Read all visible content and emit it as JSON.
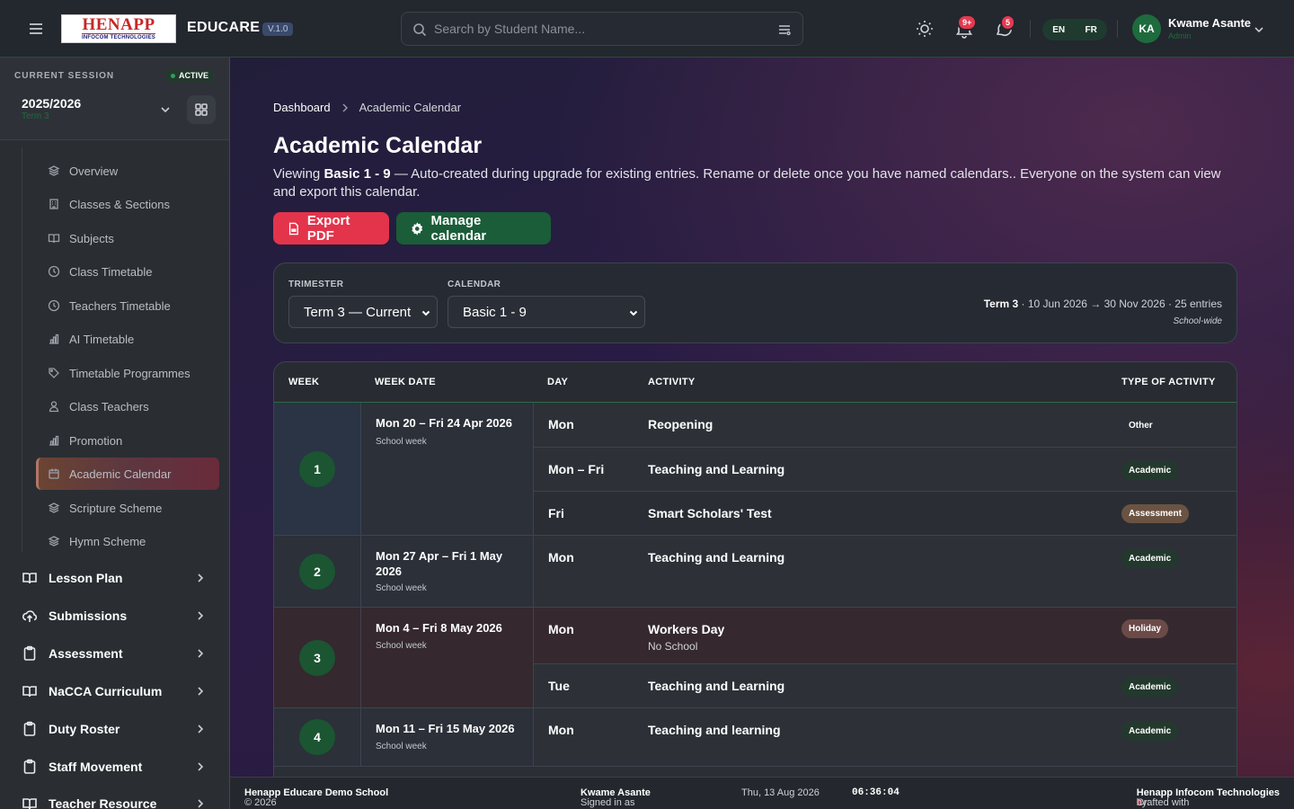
{
  "app": {
    "brand": "EDUCARE",
    "version": "V.1.0",
    "logo_main": "HENAPP",
    "logo_sub": "INFOCOM TECHNOLOGIES"
  },
  "search": {
    "placeholder": "Search by Student Name..."
  },
  "topbar": {
    "notif_badge": "9+",
    "msg_badge": "5",
    "lang_en": "EN",
    "lang_fr": "FR",
    "user_initials": "KA",
    "user_name": "Kwame Asante",
    "user_role": "Admin"
  },
  "session": {
    "label": "CURRENT SESSION",
    "status": "ACTIVE",
    "year": "2025/2026",
    "term": "Term 3"
  },
  "sidebar": {
    "items": [
      {
        "label": "Overview",
        "icon": "layers-icon"
      },
      {
        "label": "Classes & Sections",
        "icon": "building-icon"
      },
      {
        "label": "Subjects",
        "icon": "book-icon"
      },
      {
        "label": "Class Timetable",
        "icon": "clock-icon"
      },
      {
        "label": "Teachers Timetable",
        "icon": "clock-icon"
      },
      {
        "label": "AI Timetable",
        "icon": "chart-icon"
      },
      {
        "label": "Timetable Programmes",
        "icon": "tag-icon"
      },
      {
        "label": "Class Teachers",
        "icon": "user-icon"
      },
      {
        "label": "Promotion",
        "icon": "chart-icon"
      },
      {
        "label": "Academic Calendar",
        "icon": "calendar-icon"
      },
      {
        "label": "Scripture Scheme",
        "icon": "layers-icon"
      },
      {
        "label": "Hymn Scheme",
        "icon": "layers-icon"
      }
    ],
    "groups": [
      {
        "label": "Lesson Plan"
      },
      {
        "label": "Submissions"
      },
      {
        "label": "Assessment"
      },
      {
        "label": "NaCCA Curriculum"
      },
      {
        "label": "Duty Roster"
      },
      {
        "label": "Staff Movement"
      },
      {
        "label": "Teacher Resource"
      }
    ]
  },
  "breadcrumb": {
    "home": "Dashboard",
    "current": "Academic Calendar"
  },
  "page": {
    "title": "Academic Calendar",
    "intro_prefix": "Viewing ",
    "intro_bold": "Basic 1 - 9",
    "intro_rest": " — Auto-created during upgrade for existing entries. Rename or delete once you have named calendars.. Everyone on the system can view and export this calendar.",
    "export_btn": "Export PDF",
    "manage_btn": "Manage calendar"
  },
  "filters": {
    "trimester_label": "TRIMESTER",
    "trimester_value": "Term 3 — Current",
    "calendar_label": "CALENDAR",
    "calendar_value": "Basic 1 - 9",
    "meta_term": "Term 3",
    "meta_rest": " · 10 Jun 2026 → 30 Nov 2026 · 25 entries",
    "scope": "School-wide"
  },
  "table": {
    "headers": {
      "week": "WEEK",
      "date": "WEEK DATE",
      "day": "DAY",
      "activity": "ACTIVITY",
      "type": "TYPE OF ACTIVITY"
    },
    "weeks": [
      {
        "num": "1",
        "date": "Mon 20 – Fri 24 Apr 2026",
        "sub": "School week"
      },
      {
        "num": "2",
        "date": "Mon 27 Apr – Fri 1 May 2026",
        "sub": "School week"
      },
      {
        "num": "3",
        "date": "Mon 4 – Fri 8 May 2026",
        "sub": "School week"
      },
      {
        "num": "4",
        "date": "Mon 11 – Fri 15 May 2026",
        "sub": "School week"
      }
    ],
    "rows": [
      {
        "day": "Mon",
        "activity": "Reopening",
        "sub": "",
        "type": "Other"
      },
      {
        "day": "Mon – Fri",
        "activity": "Teaching and Learning",
        "sub": "",
        "type": "Academic"
      },
      {
        "day": "Fri",
        "activity": "Smart Scholars' Test",
        "sub": "",
        "type": "Assessment"
      },
      {
        "day": "Mon",
        "activity": "Teaching and Learning",
        "sub": "",
        "type": "Academic"
      },
      {
        "day": "Mon",
        "activity": "Workers Day",
        "sub": "No School",
        "type": "Holiday"
      },
      {
        "day": "Tue",
        "activity": "Teaching and Learning",
        "sub": "",
        "type": "Academic"
      },
      {
        "day": "Mon",
        "activity": "Teaching and learning",
        "sub": "",
        "type": "Academic"
      }
    ]
  },
  "footer": {
    "copyright": "© 2026 ",
    "school": "Henapp Educare Demo School",
    "signed_prefix": "Signed in as ",
    "signed_user": "Kwame Asante",
    "date": "Thu, 13 Aug 2026",
    "time": "06:36:04",
    "crafted_prefix": "Crafted with ",
    "crafted_mid": " by: ",
    "crafted_by": "Henapp Infocom Technologies"
  },
  "colors": {
    "accent": "#1a5d38",
    "danger": "#e3344b",
    "sidebar_active": "#6b4433"
  }
}
